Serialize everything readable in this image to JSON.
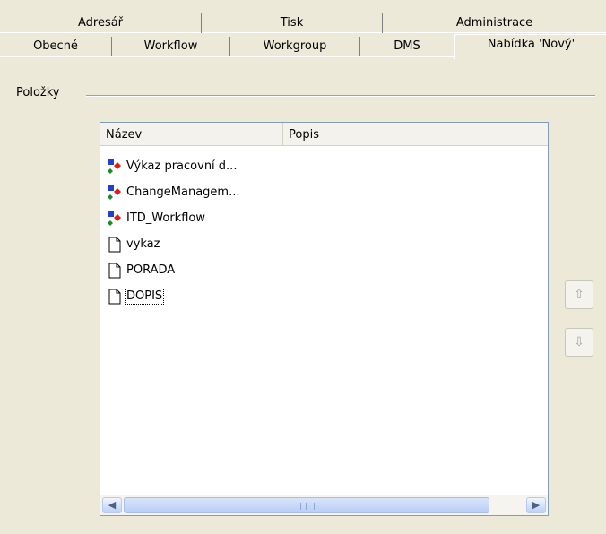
{
  "tabs_row1": [
    "Adresář",
    "Tisk",
    "Administrace"
  ],
  "tabs_row2": [
    "Obecné",
    "Workflow",
    "Workgroup",
    "DMS",
    "Nabídka 'Nový'"
  ],
  "group": {
    "label": "Položky"
  },
  "list": {
    "columns": [
      "Název",
      "Popis"
    ],
    "items": [
      {
        "name": "Výkaz pracovní d...",
        "icon": "workflow-icon"
      },
      {
        "name": "ChangeManagem...",
        "icon": "workflow-icon"
      },
      {
        "name": "ITD_Workflow",
        "icon": "workflow-icon"
      },
      {
        "name": "vykaz",
        "icon": "document-icon"
      },
      {
        "name": "PORADA",
        "icon": "document-icon"
      },
      {
        "name": "DOPIS",
        "icon": "document-icon",
        "focused": true
      }
    ]
  },
  "buttons": {
    "move_up": "⇧",
    "move_down": "⇩"
  },
  "scrollbar": {
    "left": "◀",
    "right": "▶"
  }
}
